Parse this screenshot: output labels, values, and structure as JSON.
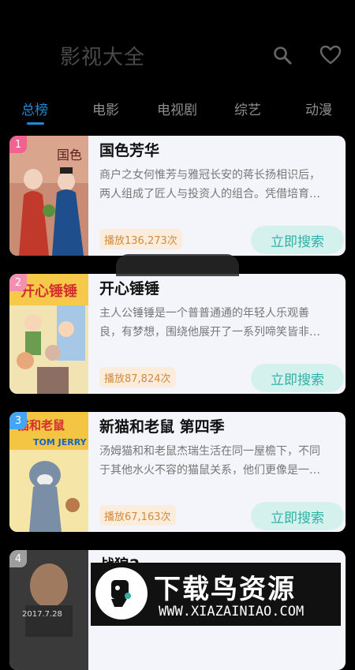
{
  "header": {
    "title": "影视大全",
    "search_icon": "search-icon",
    "favorite_icon": "heart-icon"
  },
  "tabs": [
    {
      "label": "总榜",
      "active": true
    },
    {
      "label": "电影",
      "active": false
    },
    {
      "label": "电视剧",
      "active": false
    },
    {
      "label": "综艺",
      "active": false
    },
    {
      "label": "动漫",
      "active": false
    }
  ],
  "items": [
    {
      "rank": "1",
      "rank_color": "#f06292",
      "title": "国色芳华",
      "desc_line1": "商户之女何惟芳与雅冠长安的蒋长扬相识后，",
      "desc_line2": "两人组成了匠人与投资人的组合。凭借培育…",
      "plays": "播放136,273次",
      "button": "立即搜索"
    },
    {
      "rank": "2",
      "rank_color": "#f48fb1",
      "title": "开心锤锤",
      "desc_line1": "主人公锤锤是一个普普通通的年轻人乐观善",
      "desc_line2": "良，有梦想，围绕他展开了一系列啼笑皆非…",
      "plays": "播放87,824次",
      "button": "立即搜索"
    },
    {
      "rank": "3",
      "rank_color": "#42a5f5",
      "title": "新猫和老鼠 第四季",
      "desc_line1": "汤姆猫和和老鼠杰瑞生活在同一屋檐下，不同",
      "desc_line2": "于其他水火不容的猫鼠关系，他们更像是一…",
      "plays": "播放67,163次",
      "button": "立即搜索"
    },
    {
      "rank": "4",
      "rank_color": "#9e9e9e",
      "title": "战狼2",
      "poster_date": "2017.7.28"
    }
  ],
  "watermark": {
    "logo_text": "下载鸟资源",
    "url": "WWW.XIAZAINIAO.COM"
  },
  "colors": {
    "accent": "#1e8bd6",
    "button_bg": "#d5f1ee",
    "button_text": "#2fb1a6",
    "badge_bg": "#fbecdc",
    "badge_text": "#d28a3c"
  }
}
